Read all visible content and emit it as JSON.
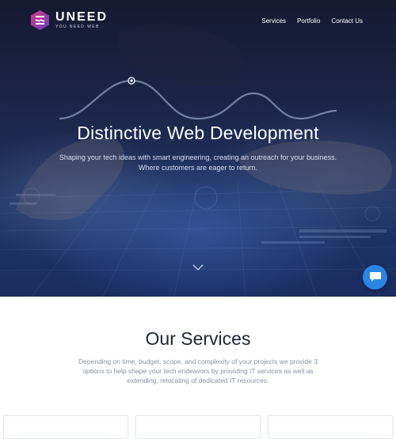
{
  "brand": {
    "name": "UNEED",
    "tagline": "YOU NEED WEB"
  },
  "nav": {
    "items": [
      {
        "label": "Services"
      },
      {
        "label": "Portfolio"
      },
      {
        "label": "Contact Us"
      }
    ]
  },
  "hero": {
    "title": "Distinctive Web Development",
    "subtitle": "Shaping your tech ideas with smart engineering, creating an outreach for your business. Where customers are eager to return."
  },
  "services": {
    "title": "Our Services",
    "description": "Depending on time, budget, scope, and complexity of your projects we provide 3 options to help shape your tech endeavors by providing IT services as well as extending, relocating of dedicated IT resources."
  },
  "colors": {
    "accent": "#2a86e6",
    "logo_gradient_start": "#d63b7c",
    "logo_gradient_end": "#6a3fc4"
  },
  "icons": {
    "logo": "uneed-logo-icon",
    "scroll": "chevron-down-icon",
    "chat": "chat-bubble-icon"
  }
}
